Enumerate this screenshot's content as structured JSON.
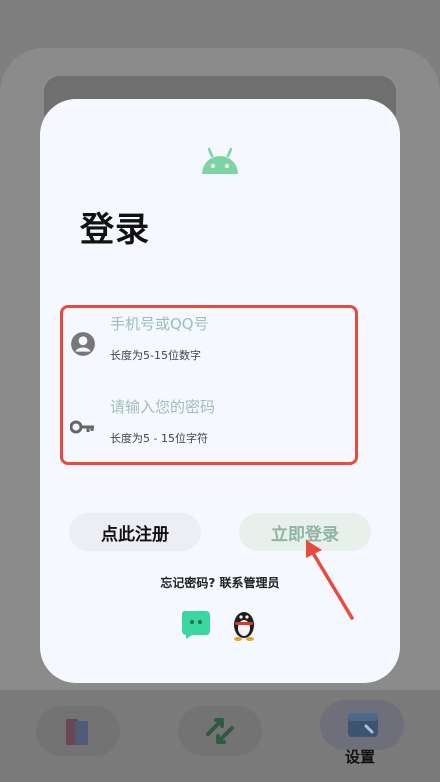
{
  "dialog": {
    "title": "登录",
    "account_field": {
      "placeholder": "手机号或QQ号",
      "hint": "长度为5-15位数字"
    },
    "password_field": {
      "placeholder": "请输入您的密码",
      "hint": "长度为5 - 15位字符"
    },
    "register_label": "点此注册",
    "login_label": "立即登录",
    "forgot_text": "忘记密码? 联系管理员"
  },
  "bottom_nav": {
    "settings_label": "设置"
  },
  "colors": {
    "android_green": "#7ed3a2",
    "annotation_red": "#e84a3d",
    "login_text": "#8fb3a5",
    "placeholder": "#9dbfb3",
    "dialog_bg": "#f6f8ff"
  },
  "icons": {
    "app_logo": "android-icon",
    "account": "account-circle-icon",
    "password": "key-icon",
    "wechat": "wechat-icon",
    "qq": "qq-penguin-icon",
    "pointer": "red-arrow-icon"
  }
}
